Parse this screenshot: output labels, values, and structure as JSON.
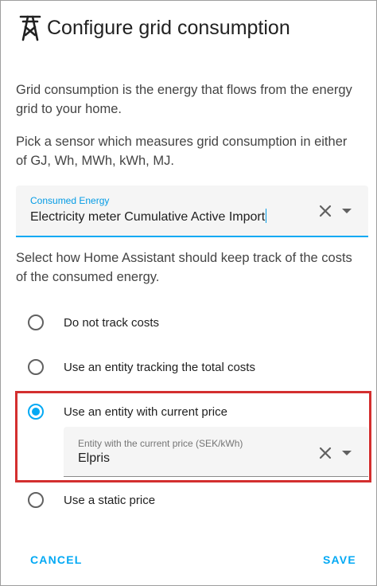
{
  "dialog": {
    "title": "Configure grid consumption",
    "title_icon": "transmission-tower-icon",
    "intro": "Grid consumption is the energy that flows from the energy grid to your home.",
    "sensor_hint": "Pick a sensor which measures grid consumption in either of GJ, Wh, MWh, kWh, MJ.",
    "cost_hint": "Select how Home Assistant should keep track of the costs of the consumed energy."
  },
  "sensor_field": {
    "label": "Consumed Energy",
    "value": "Electricity meter Cumulative Active Import"
  },
  "cost_options": [
    {
      "label": "Do not track costs",
      "checked": false
    },
    {
      "label": "Use an entity tracking the total costs",
      "checked": false
    },
    {
      "label": "Use an entity with current price",
      "checked": true
    },
    {
      "label": "Use a static price",
      "checked": false
    }
  ],
  "price_field": {
    "label": "Entity with the current price (SEK/kWh)",
    "value": "Elpris"
  },
  "actions": {
    "cancel": "CANCEL",
    "save": "SAVE"
  },
  "colors": {
    "accent": "#03a9f4",
    "highlight": "#d32f2f"
  }
}
